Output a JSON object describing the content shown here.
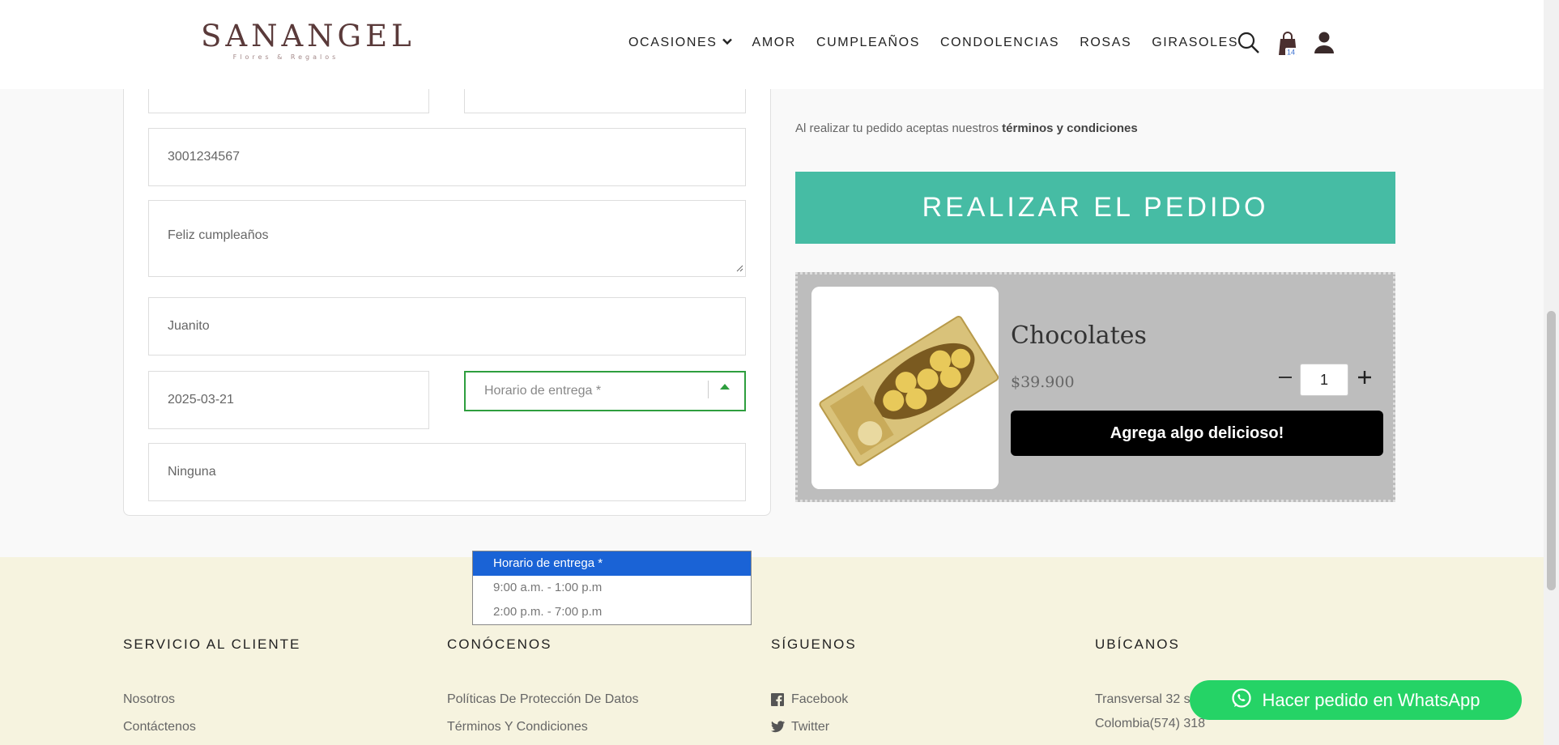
{
  "header": {
    "logo_main": "SANANGEL",
    "logo_sub": "Flores & Regalos",
    "nav": [
      {
        "label": "OCASIONES"
      },
      {
        "label": "AMOR"
      },
      {
        "label": "CUMPLEAÑOS"
      },
      {
        "label": "CONDOLENCIAS"
      },
      {
        "label": "ROSAS"
      },
      {
        "label": "GIRASOLES"
      }
    ],
    "cart_count": "14"
  },
  "form": {
    "phone": "3001234567",
    "message": "Feliz cumpleaños",
    "signature": "Juanito",
    "date": "2025-03-21",
    "delivery_time_placeholder": "Horario de entrega *",
    "notes": "Ninguna"
  },
  "dropdown": {
    "options": [
      "Horario de entrega *",
      "9:00 a.m. - 1:00 p.m",
      "2:00 p.m. - 7:00 p.m"
    ]
  },
  "checkout": {
    "terms_prefix": "Al realizar tu pedido aceptas nuestros ",
    "terms_link": "términos y condiciones",
    "order_button": "REALIZAR EL PEDIDO"
  },
  "upsell": {
    "product_name": "Chocolates",
    "price": "$39.900",
    "quantity": "1",
    "add_button": "Agrega algo delicioso!"
  },
  "footer": {
    "col1": {
      "title": "SERVICIO AL CLIENTE",
      "links": [
        "Nosotros",
        "Contáctenos"
      ]
    },
    "col2": {
      "title": "CONÓCENOS",
      "links": [
        "Políticas De Protección De Datos",
        "Términos Y Condiciones"
      ]
    },
    "col3": {
      "title": "SÍGUENOS",
      "links": [
        "Facebook",
        "Twitter"
      ]
    },
    "col4": {
      "title": "UBÍCANOS",
      "lines": [
        "Transversal 32 su",
        "Colombia(574) 318"
      ]
    }
  },
  "whatsapp_button": "Hacer pedido en WhatsApp",
  "colors": {
    "accent": "#46bca4",
    "whatsapp": "#25d366",
    "select_focus": "#2e9e3e",
    "footer_bg": "#f6f3df"
  }
}
